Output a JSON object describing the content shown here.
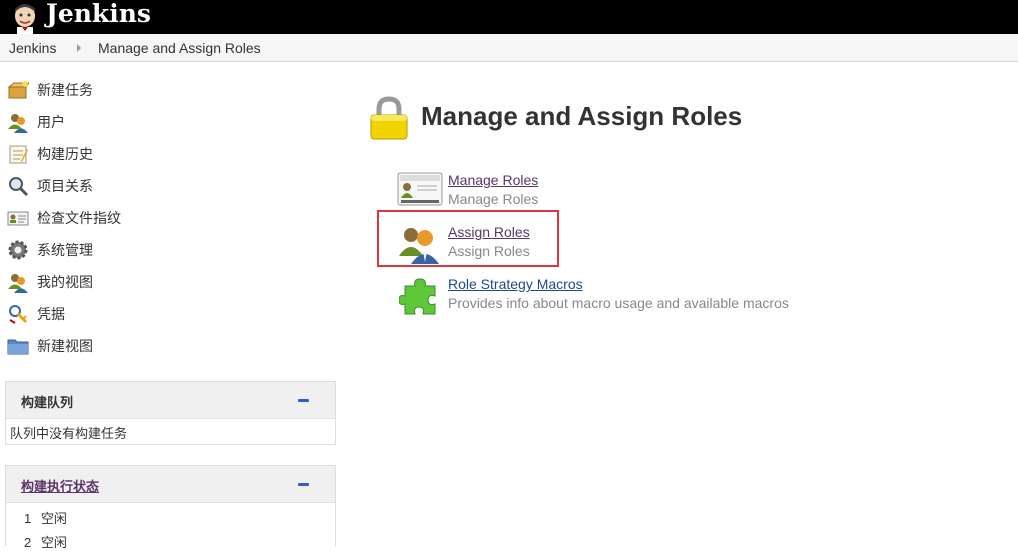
{
  "header": {
    "app_name": "Jenkins"
  },
  "breadcrumb": {
    "items": [
      "Jenkins",
      "Manage and Assign Roles"
    ]
  },
  "sidebar": {
    "tasks": [
      {
        "label": "新建任务",
        "icon": "new-package-icon"
      },
      {
        "label": "用户",
        "icon": "users-icon"
      },
      {
        "label": "构建历史",
        "icon": "notepad-icon"
      },
      {
        "label": "项目关系",
        "icon": "magnifier-icon"
      },
      {
        "label": "检查文件指纹",
        "icon": "fingerprint-card-icon"
      },
      {
        "label": "系统管理",
        "icon": "gear-icon"
      },
      {
        "label": "我的视图",
        "icon": "user-icon"
      },
      {
        "label": "凭据",
        "icon": "credentials-icon"
      },
      {
        "label": "新建视图",
        "icon": "folder-icon"
      }
    ],
    "build_queue": {
      "title": "构建队列",
      "empty_text": "队列中没有构建任务"
    },
    "executors": {
      "title": "构建执行状态",
      "items": [
        {
          "number": "1",
          "status": "空闲"
        },
        {
          "number": "2",
          "status": "空闲"
        }
      ]
    }
  },
  "main": {
    "title": "Manage and Assign Roles",
    "items": [
      {
        "link": "Manage Roles",
        "description": "Manage Roles",
        "icon": "id-card-icon"
      },
      {
        "link": "Assign Roles",
        "description": "Assign Roles",
        "icon": "users-icon"
      },
      {
        "link": "Role Strategy Macros",
        "description": "Provides info about macro usage and available macros",
        "icon": "puzzle-icon"
      }
    ]
  },
  "colors": {
    "highlight": "#e0353b",
    "header_bg": "#000000",
    "link": "#5c3566"
  }
}
